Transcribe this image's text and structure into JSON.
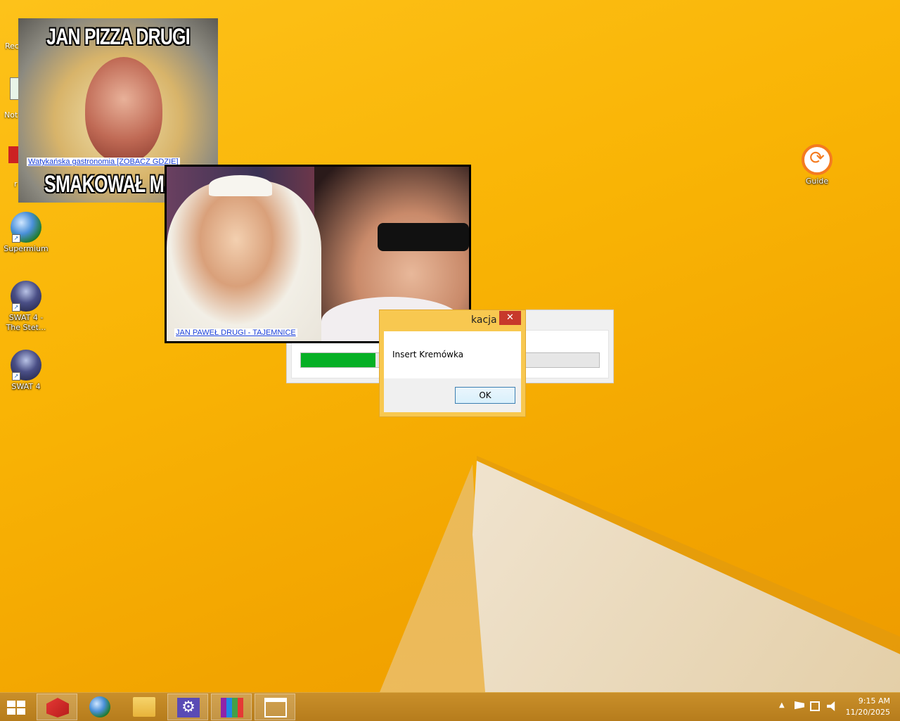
{
  "desktop": {
    "icons": [
      {
        "label": "Supermium"
      },
      {
        "label": "SWAT 4 - The Stet..."
      },
      {
        "label": "SWAT 4"
      },
      {
        "label": "Guide"
      }
    ],
    "partial_labels": [
      "Rec",
      "Not",
      "r"
    ]
  },
  "popup1": {
    "title": "JAN PIZZA DRUGI",
    "link": "Watykańska gastronomia [ZOBACZ GDZIE]",
    "bottom": "SMAKOWAŁ MAŁYM DZIECIOM"
  },
  "popup2": {
    "link": "JAN PAWEŁ DRUGI - TAJEMNICE"
  },
  "progress_window": {
    "progress": 0.25
  },
  "dialog": {
    "title_fragment": "kacja",
    "close": "✕",
    "message": "Insert Kremówka",
    "ok": "OK"
  },
  "taskbar": {
    "apps": [
      "start",
      "flag-app",
      "supermium",
      "file-explorer",
      "settings",
      "winrar",
      "window"
    ],
    "clock_time": "9:15 AM",
    "clock_date": "11/20/2025",
    "tray_arrow": "▲"
  }
}
